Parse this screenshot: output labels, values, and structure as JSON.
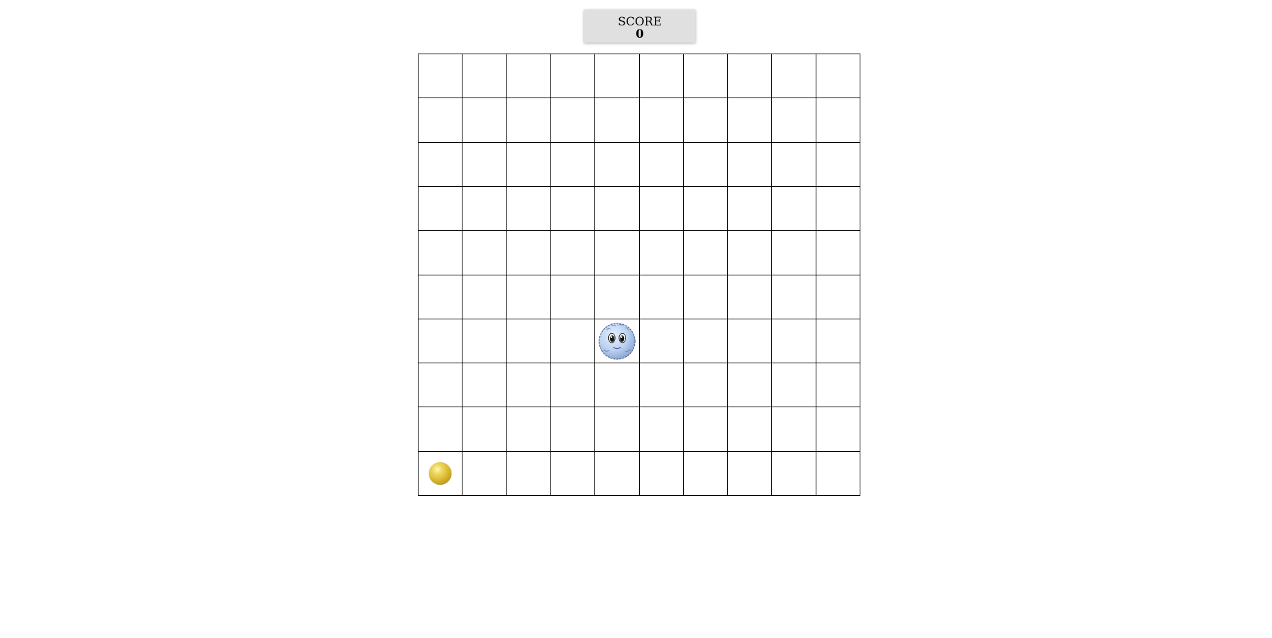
{
  "score": {
    "label": "SCORE",
    "value": "0"
  },
  "board": {
    "rows": 10,
    "cols": 10,
    "player": {
      "row": 6,
      "col": 4,
      "icon": "puffle-icon",
      "color": "#bcd3f3"
    },
    "items": [
      {
        "row": 9,
        "col": 0,
        "icon": "gold-coin-icon",
        "color": "#d6b52e"
      }
    ]
  }
}
